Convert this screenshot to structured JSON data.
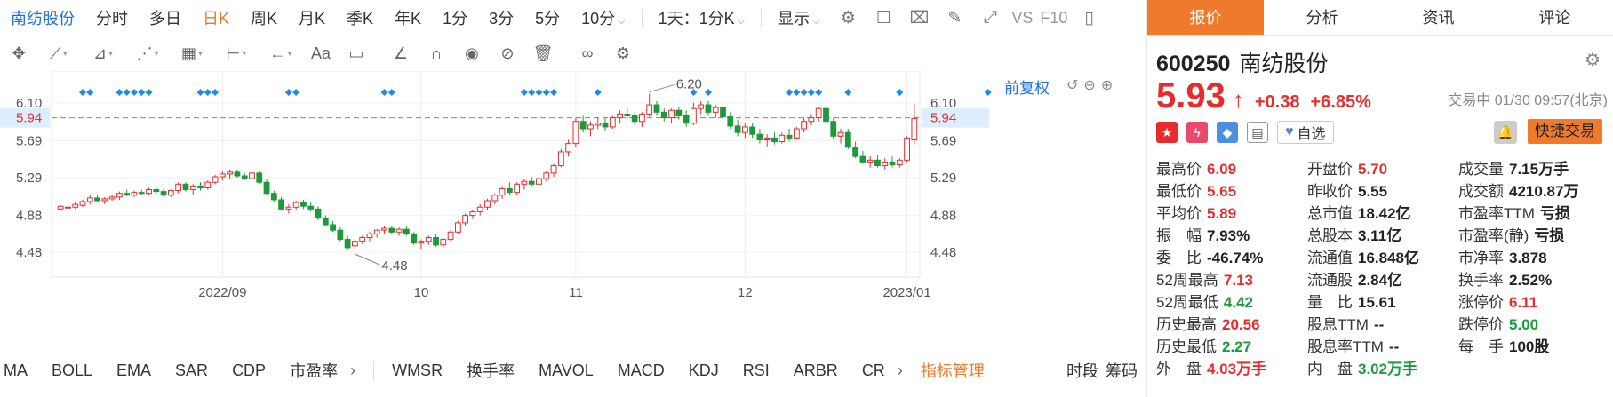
{
  "toolbar": {
    "items": [
      "南纺股份",
      "分时",
      "多日",
      "日K",
      "周K",
      "月K",
      "季K",
      "年K",
      "1分",
      "3分",
      "5分",
      "10分"
    ],
    "period_select": "1天：1分K",
    "display": "显示",
    "vs": "VS",
    "f10": "F10"
  },
  "chart": {
    "fuquan": "前复权",
    "current_price_label": "5.94",
    "y_ticks": [
      "6.10",
      "5.69",
      "5.29",
      "4.88",
      "4.48"
    ],
    "x_labels": [
      "2022/09",
      "10",
      "11",
      "12",
      "2023/01"
    ],
    "annotations": {
      "high": "6.20",
      "low": "4.48"
    },
    "colors": {
      "up": "#e62c2c",
      "down": "#1d9a3a",
      "marker": "#1e8be8",
      "price_line": "#f07a2b"
    }
  },
  "chart_data": {
    "type": "candlestick",
    "ylim": [
      4.25,
      6.35
    ],
    "y_ticks": [
      6.1,
      5.69,
      5.29,
      4.88,
      4.48
    ],
    "x_tick_labels": [
      "2022/09",
      "10",
      "11",
      "12",
      "2023/01"
    ],
    "current_price": 5.94,
    "marked_high": 6.2,
    "marked_low": 4.48,
    "ohlc": [
      [
        4.95,
        4.99,
        4.93,
        4.98
      ],
      [
        4.97,
        5.0,
        4.94,
        4.97
      ],
      [
        4.97,
        5.02,
        4.95,
        5.0
      ],
      [
        4.99,
        5.05,
        4.97,
        5.03
      ],
      [
        5.03,
        5.1,
        5.0,
        5.07
      ],
      [
        5.07,
        5.1,
        5.02,
        5.04
      ],
      [
        5.04,
        5.08,
        5.0,
        5.06
      ],
      [
        5.06,
        5.1,
        5.04,
        5.08
      ],
      [
        5.08,
        5.14,
        5.05,
        5.12
      ],
      [
        5.12,
        5.16,
        5.09,
        5.1
      ],
      [
        5.1,
        5.15,
        5.08,
        5.13
      ],
      [
        5.13,
        5.16,
        5.1,
        5.12
      ],
      [
        5.12,
        5.18,
        5.1,
        5.16
      ],
      [
        5.16,
        5.2,
        5.12,
        5.14
      ],
      [
        5.14,
        5.17,
        5.08,
        5.1
      ],
      [
        5.1,
        5.16,
        5.08,
        5.15
      ],
      [
        5.15,
        5.24,
        5.12,
        5.22
      ],
      [
        5.22,
        5.24,
        5.14,
        5.16
      ],
      [
        5.16,
        5.22,
        5.1,
        5.2
      ],
      [
        5.2,
        5.24,
        5.15,
        5.18
      ],
      [
        5.18,
        5.26,
        5.16,
        5.24
      ],
      [
        5.24,
        5.32,
        5.22,
        5.3
      ],
      [
        5.3,
        5.36,
        5.26,
        5.33
      ],
      [
        5.33,
        5.38,
        5.28,
        5.35
      ],
      [
        5.35,
        5.38,
        5.29,
        5.31
      ],
      [
        5.31,
        5.34,
        5.26,
        5.28
      ],
      [
        5.28,
        5.36,
        5.26,
        5.34
      ],
      [
        5.34,
        5.36,
        5.22,
        5.24
      ],
      [
        5.24,
        5.28,
        5.1,
        5.12
      ],
      [
        5.12,
        5.15,
        5.03,
        5.05
      ],
      [
        5.05,
        5.08,
        4.93,
        4.95
      ],
      [
        4.95,
        5.0,
        4.9,
        4.97
      ],
      [
        4.97,
        5.04,
        4.94,
        5.02
      ],
      [
        5.02,
        5.05,
        4.95,
        4.98
      ],
      [
        4.98,
        5.02,
        4.92,
        4.95
      ],
      [
        4.95,
        4.98,
        4.83,
        4.85
      ],
      [
        4.85,
        4.88,
        4.76,
        4.78
      ],
      [
        4.78,
        4.82,
        4.7,
        4.72
      ],
      [
        4.72,
        4.75,
        4.6,
        4.62
      ],
      [
        4.62,
        4.66,
        4.5,
        4.53
      ],
      [
        4.55,
        4.62,
        4.48,
        4.6
      ],
      [
        4.6,
        4.66,
        4.57,
        4.64
      ],
      [
        4.64,
        4.7,
        4.6,
        4.68
      ],
      [
        4.68,
        4.73,
        4.64,
        4.72
      ],
      [
        4.72,
        4.76,
        4.68,
        4.74
      ],
      [
        4.74,
        4.76,
        4.68,
        4.7
      ],
      [
        4.7,
        4.75,
        4.66,
        4.73
      ],
      [
        4.73,
        4.76,
        4.66,
        4.68
      ],
      [
        4.68,
        4.7,
        4.56,
        4.58
      ],
      [
        4.58,
        4.62,
        4.52,
        4.6
      ],
      [
        4.6,
        4.66,
        4.56,
        4.64
      ],
      [
        4.64,
        4.68,
        4.54,
        4.56
      ],
      [
        4.56,
        4.64,
        4.53,
        4.62
      ],
      [
        4.62,
        4.72,
        4.6,
        4.7
      ],
      [
        4.7,
        4.82,
        4.68,
        4.8
      ],
      [
        4.8,
        4.9,
        4.77,
        4.88
      ],
      [
        4.88,
        4.94,
        4.84,
        4.92
      ],
      [
        4.92,
        5.0,
        4.88,
        4.97
      ],
      [
        4.97,
        5.06,
        4.94,
        5.04
      ],
      [
        5.04,
        5.12,
        5.0,
        5.1
      ],
      [
        5.1,
        5.2,
        5.06,
        5.17
      ],
      [
        5.17,
        5.24,
        5.1,
        5.13
      ],
      [
        5.13,
        5.24,
        5.1,
        5.22
      ],
      [
        5.22,
        5.27,
        5.16,
        5.25
      ],
      [
        5.25,
        5.3,
        5.2,
        5.22
      ],
      [
        5.22,
        5.3,
        5.2,
        5.28
      ],
      [
        5.28,
        5.36,
        5.25,
        5.34
      ],
      [
        5.34,
        5.44,
        5.3,
        5.42
      ],
      [
        5.42,
        5.6,
        5.4,
        5.57
      ],
      [
        5.57,
        5.7,
        5.52,
        5.66
      ],
      [
        5.66,
        5.94,
        5.62,
        5.9
      ],
      [
        5.9,
        5.96,
        5.78,
        5.82
      ],
      [
        5.82,
        5.9,
        5.74,
        5.86
      ],
      [
        5.86,
        5.94,
        5.82,
        5.88
      ],
      [
        5.88,
        5.94,
        5.8,
        5.84
      ],
      [
        5.84,
        5.96,
        5.82,
        5.94
      ],
      [
        5.94,
        6.02,
        5.88,
        5.98
      ],
      [
        5.98,
        6.04,
        5.92,
        5.96
      ],
      [
        5.96,
        6.0,
        5.86,
        5.9
      ],
      [
        5.9,
        6.0,
        5.84,
        5.98
      ],
      [
        5.98,
        6.2,
        5.95,
        6.08
      ],
      [
        6.08,
        6.12,
        5.96,
        6.0
      ],
      [
        6.0,
        6.04,
        5.9,
        5.94
      ],
      [
        5.94,
        6.04,
        5.88,
        6.02
      ],
      [
        6.02,
        6.06,
        5.92,
        5.96
      ],
      [
        5.96,
        6.02,
        5.84,
        5.88
      ],
      [
        5.88,
        6.1,
        5.86,
        6.04
      ],
      [
        6.04,
        6.12,
        5.98,
        6.08
      ],
      [
        6.08,
        6.12,
        5.96,
        6.0
      ],
      [
        6.0,
        6.08,
        5.94,
        6.05
      ],
      [
        6.05,
        6.08,
        5.92,
        5.95
      ],
      [
        5.95,
        6.0,
        5.82,
        5.85
      ],
      [
        5.85,
        5.92,
        5.74,
        5.78
      ],
      [
        5.78,
        5.88,
        5.72,
        5.84
      ],
      [
        5.84,
        5.88,
        5.72,
        5.76
      ],
      [
        5.76,
        5.82,
        5.66,
        5.7
      ],
      [
        5.7,
        5.76,
        5.62,
        5.72
      ],
      [
        5.72,
        5.78,
        5.65,
        5.68
      ],
      [
        5.68,
        5.78,
        5.66,
        5.75
      ],
      [
        5.75,
        5.82,
        5.68,
        5.72
      ],
      [
        5.72,
        5.84,
        5.7,
        5.82
      ],
      [
        5.82,
        5.94,
        5.78,
        5.9
      ],
      [
        5.9,
        5.98,
        5.86,
        5.94
      ],
      [
        5.94,
        6.06,
        5.9,
        6.04
      ],
      [
        6.04,
        6.06,
        5.88,
        5.9
      ],
      [
        5.9,
        5.94,
        5.7,
        5.74
      ],
      [
        5.74,
        5.82,
        5.66,
        5.78
      ],
      [
        5.78,
        5.82,
        5.6,
        5.62
      ],
      [
        5.62,
        5.68,
        5.5,
        5.52
      ],
      [
        5.52,
        5.58,
        5.44,
        5.46
      ],
      [
        5.46,
        5.52,
        5.4,
        5.48
      ],
      [
        5.48,
        5.54,
        5.4,
        5.42
      ],
      [
        5.42,
        5.5,
        5.38,
        5.46
      ],
      [
        5.46,
        5.52,
        5.4,
        5.43
      ],
      [
        5.43,
        5.5,
        5.4,
        5.48
      ],
      [
        5.48,
        5.74,
        5.46,
        5.72
      ],
      [
        5.7,
        6.09,
        5.65,
        5.93
      ]
    ],
    "event_markers": [
      3,
      4,
      8,
      9,
      10,
      11,
      12,
      19,
      20,
      21,
      31,
      32,
      44,
      45,
      63,
      64,
      65,
      66,
      67,
      73,
      86,
      88,
      99,
      100,
      101,
      102,
      103,
      107,
      114,
      126
    ]
  },
  "indicators": {
    "items": [
      "MA",
      "BOLL",
      "EMA",
      "SAR",
      "CDP",
      "市盈率"
    ],
    "items2": [
      "WMSR",
      "换手率",
      "MAVOL",
      "MACD",
      "KDJ",
      "RSI",
      "ARBR",
      "CR"
    ],
    "manage": "指标管理",
    "right": [
      "时段",
      "筹码"
    ]
  },
  "panel": {
    "tabs": [
      "报价",
      "分析",
      "资讯",
      "评论"
    ],
    "code": "600250",
    "name": "南纺股份",
    "price": "5.93",
    "change": "+0.38",
    "change_pct": "+6.85%",
    "status": "交易中 01/30 09:57(北京)",
    "watch": "自选",
    "quick_trade": "快捷交易",
    "stats": [
      [
        {
          "l": "最高价",
          "v": "6.09",
          "c": "red"
        },
        {
          "l": "开盘价",
          "v": "5.70",
          "c": "red"
        },
        {
          "l": "成交量",
          "v": "7.15万手",
          "c": "blk"
        }
      ],
      [
        {
          "l": "最低价",
          "v": "5.65",
          "c": "red"
        },
        {
          "l": "昨收价",
          "v": "5.55",
          "c": "blk"
        },
        {
          "l": "成交额",
          "v": "4210.87万",
          "c": "blk"
        }
      ],
      [
        {
          "l": "平均价",
          "v": "5.89",
          "c": "red"
        },
        {
          "l": "总市值",
          "v": "18.42亿",
          "c": "blk"
        },
        {
          "l": "市盈率TTM",
          "v": "亏损",
          "c": "blk"
        }
      ],
      [
        {
          "l": "振　幅",
          "v": "7.93%",
          "c": "blk"
        },
        {
          "l": "总股本",
          "v": "3.11亿",
          "c": "blk"
        },
        {
          "l": "市盈率(静)",
          "v": "亏损",
          "c": "blk"
        }
      ],
      [
        {
          "l": "委　比",
          "v": "-46.74%",
          "c": "blk"
        },
        {
          "l": "流通值",
          "v": "16.848亿",
          "c": "blk"
        },
        {
          "l": "市净率",
          "v": "3.878",
          "c": "blk"
        }
      ],
      [
        {
          "l": "52周最高",
          "v": "7.13",
          "c": "red"
        },
        {
          "l": "流通股",
          "v": "2.84亿",
          "c": "blk"
        },
        {
          "l": "换手率",
          "v": "2.52%",
          "c": "blk"
        }
      ],
      [
        {
          "l": "52周最低",
          "v": "4.42",
          "c": "green"
        },
        {
          "l": "量　比",
          "v": "15.61",
          "c": "blk"
        },
        {
          "l": "涨停价",
          "v": "6.11",
          "c": "red"
        }
      ],
      [
        {
          "l": "历史最高",
          "v": "20.56",
          "c": "red"
        },
        {
          "l": "股息TTM",
          "v": "--",
          "c": "blk"
        },
        {
          "l": "跌停价",
          "v": "5.00",
          "c": "green"
        }
      ],
      [
        {
          "l": "历史最低",
          "v": "2.27",
          "c": "green"
        },
        {
          "l": "股息率TTM",
          "v": "--",
          "c": "blk"
        },
        {
          "l": "每　手",
          "v": "100股",
          "c": "blk"
        }
      ],
      [
        {
          "l": "外　盘",
          "v": "4.03万手",
          "c": "red"
        },
        {
          "l": "内　盘",
          "v": "3.02万手",
          "c": "green"
        },
        {
          "l": "",
          "v": "",
          "c": "blk"
        }
      ]
    ]
  }
}
